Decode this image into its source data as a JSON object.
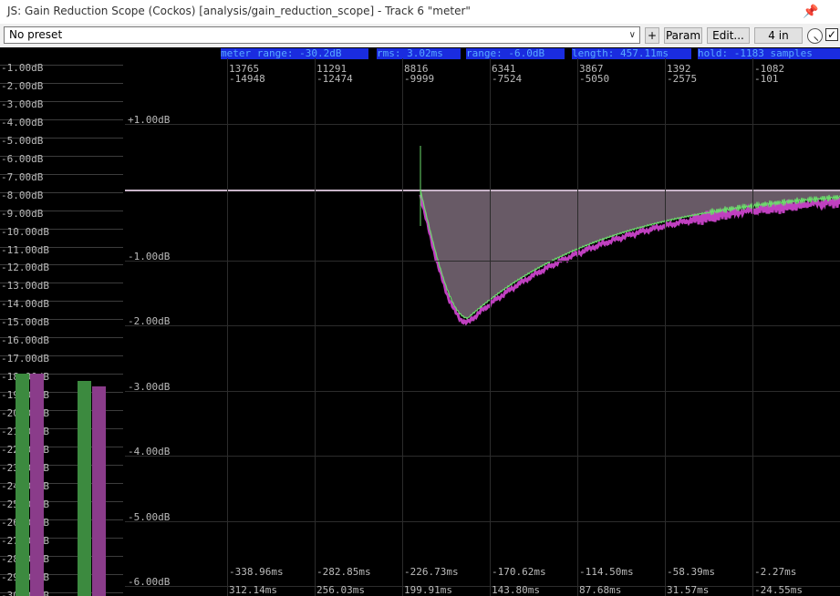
{
  "window": {
    "title": "JS: Gain Reduction Scope (Cockos) [analysis/gain_reduction_scope] - Track 6 \"meter\""
  },
  "toolbar": {
    "preset": "No preset",
    "plus": "+",
    "param": "Param",
    "edit": "Edit...",
    "io": "4 in",
    "bypass_checked": true
  },
  "stats": {
    "meter_range": "meter range: -30.2dB",
    "rms": "rms: 3.02ms",
    "range": "range: -6.0dB",
    "length": "length: 457.11ms",
    "hold": "hold: -1183 samples"
  },
  "meter": {
    "labels": [
      "-1.00dB",
      "-2.00dB",
      "-3.00dB",
      "-4.00dB",
      "-5.00dB",
      "-6.00dB",
      "-7.00dB",
      "-8.00dB",
      "-9.00dB",
      "-10.00dB",
      "-11.00dB",
      "-12.00dB",
      "-13.00dB",
      "-14.00dB",
      "-15.00dB",
      "-16.00dB",
      "-17.00dB",
      "-18.00dB",
      "-19.00dB",
      "-20.00dB",
      "-21.00dB",
      "-22.00dB",
      "-23.00dB",
      "-24.00dB",
      "-25.00dB",
      "-26.00dB",
      "-27.00dB",
      "-28.00dB",
      "-29.00dB",
      "-30.00dB"
    ],
    "bars": [
      {
        "color": "#3c8a3f",
        "level_db": -18.0
      },
      {
        "color": "#8a3c8a",
        "level_db": -18.0
      },
      {
        "color": "#3c8a3f",
        "level_db": -18.4
      },
      {
        "color": "#8a3c8a",
        "level_db": -18.7
      }
    ]
  },
  "scope": {
    "top_labels": [
      [
        "13765",
        "-14948"
      ],
      [
        "11291",
        "-12474"
      ],
      [
        "8816",
        "-9999"
      ],
      [
        "6341",
        "-7524"
      ],
      [
        "3867",
        "-5050"
      ],
      [
        "1392",
        "-2575"
      ],
      [
        "-1082",
        "-101"
      ]
    ],
    "y_labels": [
      "+1.00dB",
      "-1.00dB",
      "-2.00dB",
      "-3.00dB",
      "-4.00dB",
      "-5.00dB",
      "-6.00dB"
    ],
    "time_top": [
      "-338.96ms",
      "-282.85ms",
      "-226.73ms",
      "-170.62ms",
      "-114.50ms",
      "-58.39ms",
      "-2.27ms"
    ],
    "time_bottom": [
      "312.14ms",
      "256.03ms",
      "199.91ms",
      "143.80ms",
      "87.68ms",
      "31.57ms",
      "-24.55ms"
    ],
    "colors": {
      "green": "#6cdc6c",
      "purple": "#c040c0",
      "fill": "#7a6a78",
      "line": "#c8b4c8"
    }
  }
}
